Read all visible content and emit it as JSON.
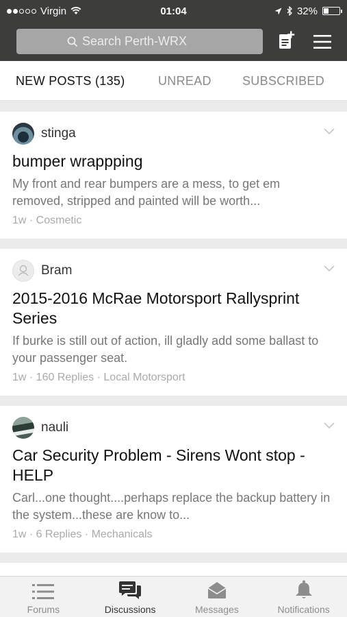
{
  "status_bar": {
    "carrier": "Virgin",
    "time": "01:04",
    "battery_percent": "32%",
    "battery_level": 0.32
  },
  "search": {
    "placeholder": "Search Perth-WRX"
  },
  "tabs": [
    {
      "label": "NEW POSTS (135)",
      "active": true
    },
    {
      "label": "UNREAD",
      "active": false
    },
    {
      "label": "SUBSCRIBED",
      "active": false
    }
  ],
  "posts": [
    {
      "author": "stinga",
      "title": "bumper wrappping",
      "excerpt": "My front and rear bumpers are a mess, to get em removed, stripped and painted will be worth...",
      "meta": "1w · Cosmetic"
    },
    {
      "author": "Bram",
      "title": "2015-2016 McRae Motorsport Rallysprint Series",
      "excerpt": "If burke is still out of action, ill gladly add some ballast to your passenger seat.",
      "meta": "1w · 160 Replies · Local Motorsport"
    },
    {
      "author": "nauli",
      "title": "Car Security Problem - Sirens Wont stop - HELP",
      "excerpt": "Carl...one thought....perhaps replace the backup battery in the system...these are know to...",
      "meta": "1w · 6 Replies · Mechanicals"
    }
  ],
  "bottom_nav": [
    {
      "label": "Forums",
      "icon": "list-icon",
      "active": false
    },
    {
      "label": "Discussions",
      "icon": "chat-bubbles-icon",
      "active": true
    },
    {
      "label": "Messages",
      "icon": "envelope-icon",
      "active": false
    },
    {
      "label": "Notifications",
      "icon": "bell-icon",
      "active": false
    }
  ],
  "colors": {
    "header_bg": "#3d3d3b",
    "search_bg": "#a6a6a6",
    "page_bg": "#ebebeb",
    "active_text": "#111111",
    "muted_text": "#8a8a8a"
  }
}
